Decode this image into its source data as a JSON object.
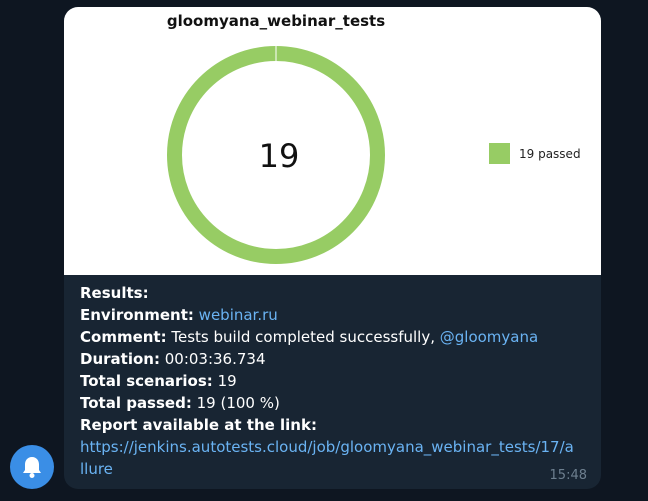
{
  "chart": {
    "title": "gloomyana_webinar_tests",
    "center_label": "19",
    "legend_label": "19 passed",
    "passed_color": "#97cc64"
  },
  "chart_data": {
    "type": "pie",
    "title": "gloomyana_webinar_tests",
    "categories": [
      "passed"
    ],
    "values": [
      19
    ],
    "legend": [
      "19 passed"
    ],
    "legend_position": "right"
  },
  "message": {
    "results_label": "Results:",
    "environment_label": "Environment:",
    "environment_value": "webinar.ru",
    "comment_label": "Comment:",
    "comment_text": "Tests build completed successfully,",
    "comment_mention": "@gloomyana",
    "duration_label": "Duration:",
    "duration_value": "00:03:36.734",
    "total_scenarios_label": "Total scenarios:",
    "total_scenarios_value": "19",
    "total_passed_label": "Total passed:",
    "total_passed_value": "19 (100 %)",
    "report_label": "Report available at the link:",
    "report_url_line1": "https://jenkins.autotests.cloud/job/gloomyana_webinar_tests/17/a",
    "report_url_line2": "llure",
    "time": "15:48"
  },
  "notification_button": {
    "icon": "bell-icon",
    "color": "#3a8ee6"
  }
}
